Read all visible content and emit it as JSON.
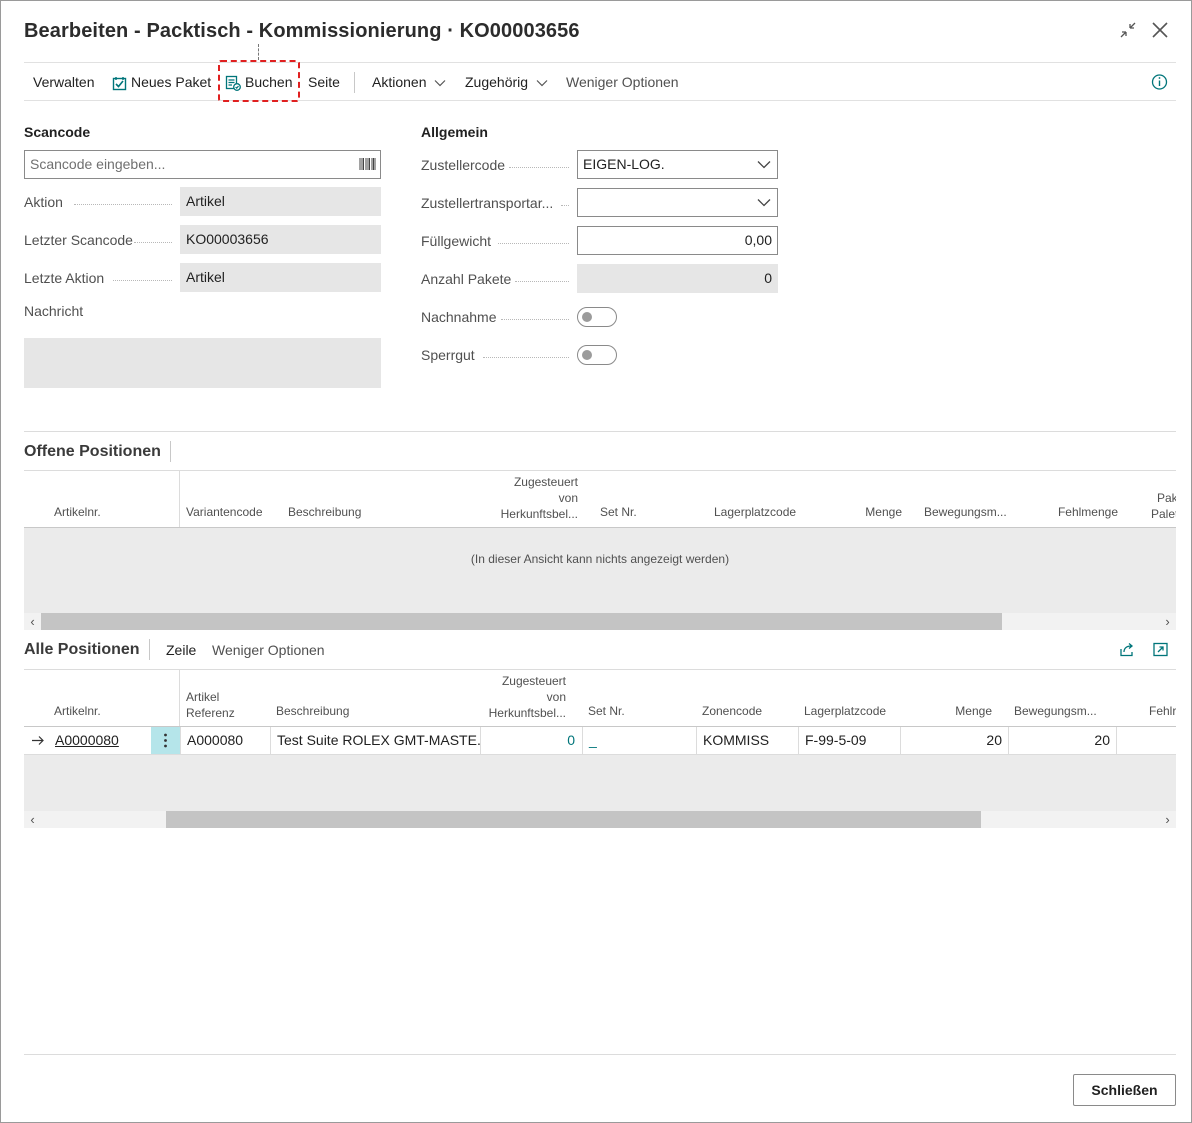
{
  "window": {
    "title": "Bearbeiten - Packtisch - Kommissionierung · KO00003656"
  },
  "toolbar": {
    "verwalten": "Verwalten",
    "neues_paket": "Neues Paket",
    "buchen": "Buchen",
    "seite": "Seite",
    "aktionen": "Aktionen",
    "zugehoerig": "Zugehörig",
    "weniger_optionen": "Weniger Optionen"
  },
  "scancode": {
    "title": "Scancode",
    "placeholder": "Scancode eingeben...",
    "aktion_label": "Aktion",
    "aktion_value": "Artikel",
    "letzter_scancode_label": "Letzter Scancode",
    "letzter_scancode_value": "KO00003656",
    "letzte_aktion_label": "Letzte Aktion",
    "letzte_aktion_value": "Artikel",
    "nachricht_label": "Nachricht",
    "nachricht_value": ""
  },
  "allgemein": {
    "title": "Allgemein",
    "zustellercode_label": "Zustellercode",
    "zustellercode_value": "EIGEN-LOG.",
    "zustellertransportart_label": "Zustellertransportar...",
    "zustellertransportart_value": "",
    "fuellgewicht_label": "Füllgewicht",
    "fuellgewicht_value": "0,00",
    "anzahl_pakete_label": "Anzahl Pakete",
    "anzahl_pakete_value": "0",
    "nachnahme_label": "Nachnahme",
    "nachnahme_value": false,
    "sperrgut_label": "Sperrgut",
    "sperrgut_value": false
  },
  "offene_positionen": {
    "title": "Offene Positionen",
    "columns": {
      "artikelnr": "Artikelnr.",
      "variantencode": "Variantencode",
      "beschreibung": "Beschreibung",
      "zugesteuert_1": "Zugesteuert",
      "zugesteuert_2": "von",
      "zugesteuert_3": "Herkunftsbel...",
      "set_nr": "Set Nr.",
      "lagerplatzcode": "Lagerplatzcode",
      "menge": "Menge",
      "bewegungsm": "Bewegungsm...",
      "fehlmenge": "Fehlmenge",
      "paket_1": "Pak",
      "paket_2": "Palet"
    },
    "empty_text": "(In dieser Ansicht kann nichts angezeigt werden)"
  },
  "alle_positionen": {
    "title": "Alle Positionen",
    "zeile": "Zeile",
    "weniger_optionen": "Weniger Optionen",
    "columns": {
      "artikelnr": "Artikelnr.",
      "artikel_ref_1": "Artikel",
      "artikel_ref_2": "Referenz",
      "beschreibung": "Beschreibung",
      "zugesteuert_1": "Zugesteuert",
      "zugesteuert_2": "von",
      "zugesteuert_3": "Herkunftsbel...",
      "set_nr": "Set Nr.",
      "zonencode": "Zonencode",
      "lagerplatzcode": "Lagerplatzcode",
      "menge": "Menge",
      "bewegungsm": "Bewegungsm...",
      "fehl": "Fehlr"
    },
    "rows": [
      {
        "artikelnr": "A0000080",
        "artikel_referenz": "A000080",
        "beschreibung": "Test Suite ROLEX GMT-MASTE...",
        "zugesteuert": "0",
        "set_nr": "_",
        "zonencode": "KOMMISS",
        "lagerplatzcode": "F-99-5-09",
        "menge": "20",
        "bewegungsm": "20"
      }
    ]
  },
  "footer": {
    "schliessen": "Schließen"
  },
  "colors": {
    "accent": "#00757a",
    "focus": "#e02020",
    "selected_cell": "#b5e5ea"
  }
}
